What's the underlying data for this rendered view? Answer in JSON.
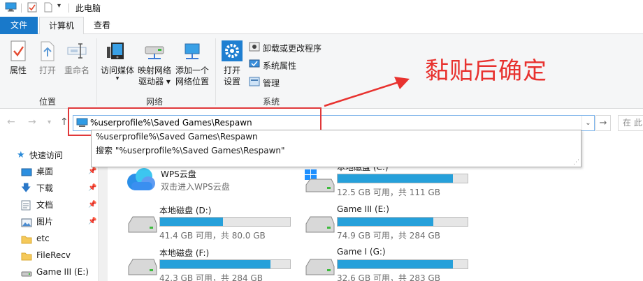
{
  "window": {
    "title": "此电脑"
  },
  "tabs": {
    "file": "文件",
    "computer": "计算机",
    "view": "查看"
  },
  "ribbon": {
    "location": {
      "label": "位置",
      "properties": "属性",
      "open": "打开",
      "rename": "重命名"
    },
    "network": {
      "label": "网络",
      "access_media": "访问媒体",
      "map_drive_1": "映射网络",
      "map_drive_2": "驱动器",
      "add_location_1": "添加一个",
      "add_location_2": "网络位置"
    },
    "system": {
      "label": "系统",
      "open_settings_1": "打开",
      "open_settings_2": "设置",
      "uninstall": "卸载或更改程序",
      "sys_props": "系统属性",
      "manage": "管理"
    }
  },
  "address": {
    "value": "%userprofile%\\Saved Games\\Respawn",
    "search_placeholder": "在 此"
  },
  "suggestions": [
    "%userprofile%\\Saved Games\\Respawn",
    "搜索 \"%userprofile%\\Saved Games\\Respawn\""
  ],
  "annotation": "黏贴后确定",
  "sidebar": {
    "items": [
      {
        "label": "快速访问"
      },
      {
        "label": "桌面"
      },
      {
        "label": "下载"
      },
      {
        "label": "文档"
      },
      {
        "label": "图片"
      },
      {
        "label": "etc"
      },
      {
        "label": "FileRecv"
      },
      {
        "label": "Game III (E:)"
      }
    ]
  },
  "drives": [
    {
      "name": "WPS云盘",
      "caption": "双击进入WPS云盘",
      "has_bar": false
    },
    {
      "name": "本地磁盘 (C:)",
      "caption": "12.5 GB 可用，共 111 GB",
      "used_fraction": 0.887
    },
    {
      "name": "本地磁盘 (D:)",
      "caption": "41.4 GB 可用，共 80.0 GB",
      "used_fraction": 0.4825
    },
    {
      "name": "Game III (E:)",
      "caption": "74.9 GB 可用，共 284 GB",
      "used_fraction": 0.736
    },
    {
      "name": "本地磁盘 (F:)",
      "caption": "42.3 GB 可用，共 284 GB",
      "used_fraction": 0.851
    },
    {
      "name": "Game I (G:)",
      "caption": "32.6 GB 可用，共 283 GB",
      "used_fraction": 0.885
    }
  ],
  "colors": {
    "accent": "#1979ca",
    "bar_fill": "#26a0da",
    "annotation": "#e8322f"
  }
}
